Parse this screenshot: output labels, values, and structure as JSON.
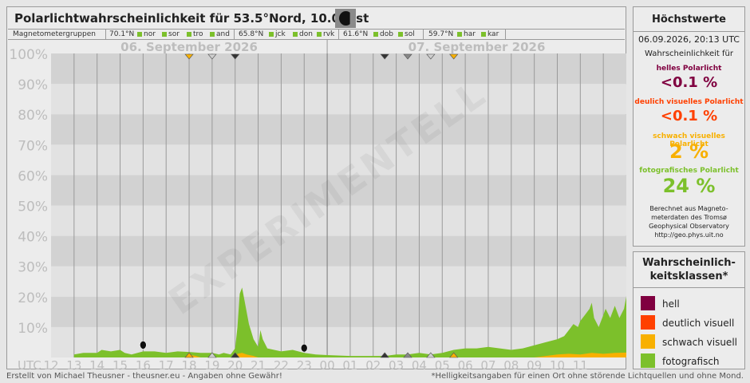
{
  "title": "Polarlichtwahrscheinlichkeit für  53.5°Nord, 10.0°Ost",
  "stations": {
    "label": "Magnetometergruppen",
    "groups": [
      {
        "lat": "70.1°N",
        "codes": [
          "nor",
          "sor",
          "tro",
          "and"
        ]
      },
      {
        "lat": "65.8°N",
        "codes": [
          "jck",
          "don",
          "rvk"
        ]
      },
      {
        "lat": "61.6°N",
        "codes": [
          "dob",
          "sol"
        ]
      },
      {
        "lat": "59.7°N",
        "codes": [
          "har",
          "kar"
        ]
      }
    ]
  },
  "colors": {
    "hell": "#800040",
    "deutlich": "#ff4000",
    "schwach": "#f8b000",
    "foto": "#7cc02b",
    "night_band": "#d2d2d2",
    "day_band": "#e2e2e2"
  },
  "chart_data": {
    "type": "area",
    "x_label": "UTC",
    "date_labels": [
      "06. September 2026",
      "07. September 2026"
    ],
    "hour_labels": [
      "12",
      "13",
      "14",
      "15",
      "16",
      "17",
      "18",
      "19",
      "20",
      "21",
      "22",
      "23",
      "00",
      "01",
      "02",
      "03",
      "04",
      "05",
      "06",
      "07",
      "08",
      "09",
      "10",
      "11"
    ],
    "y_ticks": [
      "10%",
      "20%",
      "30%",
      "40%",
      "50%",
      "60%",
      "70%",
      "80%",
      "90%",
      "100%"
    ],
    "ylim": [
      0,
      100
    ],
    "watermark": "EXPERIMENTELL",
    "series": [
      {
        "name": "fotografisch",
        "color_key": "foto",
        "points": [
          [
            12.0,
            0
          ],
          [
            13.0,
            0
          ],
          [
            13.0,
            1
          ],
          [
            13.4,
            1.5
          ],
          [
            14.0,
            1.5
          ],
          [
            14.2,
            2.5
          ],
          [
            14.6,
            2
          ],
          [
            15.0,
            2.5
          ],
          [
            15.2,
            1.5
          ],
          [
            15.5,
            1
          ],
          [
            16.0,
            2
          ],
          [
            16.5,
            2
          ],
          [
            17.0,
            1.5
          ],
          [
            17.5,
            2
          ],
          [
            18.0,
            1.8
          ],
          [
            18.5,
            1.5
          ],
          [
            19.0,
            1.5
          ],
          [
            19.3,
            1
          ],
          [
            19.5,
            1.5
          ],
          [
            19.8,
            1
          ],
          [
            20.0,
            3
          ],
          [
            20.1,
            10
          ],
          [
            20.2,
            21
          ],
          [
            20.3,
            23
          ],
          [
            20.45,
            17
          ],
          [
            20.6,
            11
          ],
          [
            20.8,
            6
          ],
          [
            21.0,
            3.5
          ],
          [
            21.1,
            9
          ],
          [
            21.2,
            6
          ],
          [
            21.4,
            3
          ],
          [
            21.7,
            2.5
          ],
          [
            22.0,
            2
          ],
          [
            22.5,
            2.5
          ],
          [
            23.0,
            1.5
          ],
          [
            23.5,
            1
          ],
          [
            24.0,
            0.8
          ],
          [
            25.0,
            0.5
          ],
          [
            26.0,
            0.5
          ],
          [
            26.5,
            0.5
          ],
          [
            27.0,
            1
          ],
          [
            27.5,
            1
          ],
          [
            28.0,
            1.5
          ],
          [
            28.5,
            1
          ],
          [
            29.0,
            1.5
          ],
          [
            29.5,
            2.5
          ],
          [
            30.0,
            3
          ],
          [
            30.5,
            3
          ],
          [
            31.0,
            3.5
          ],
          [
            31.5,
            3
          ],
          [
            32.0,
            2.5
          ],
          [
            32.5,
            3
          ],
          [
            33.0,
            4
          ],
          [
            33.5,
            5
          ],
          [
            34.0,
            6
          ],
          [
            34.3,
            7
          ],
          [
            34.5,
            9
          ],
          [
            34.7,
            11
          ],
          [
            34.9,
            10
          ],
          [
            35.0,
            12
          ],
          [
            35.2,
            14
          ],
          [
            35.4,
            16
          ],
          [
            35.5,
            18
          ],
          [
            35.6,
            13
          ],
          [
            35.8,
            10
          ],
          [
            36.0,
            14
          ],
          [
            36.1,
            16
          ],
          [
            36.3,
            13
          ],
          [
            36.5,
            17
          ],
          [
            36.7,
            13
          ],
          [
            36.9,
            16
          ],
          [
            37.0,
            20
          ]
        ]
      },
      {
        "name": "schwach visuell",
        "color_key": "schwach",
        "points": [
          [
            12.0,
            0
          ],
          [
            18.0,
            0
          ],
          [
            18.1,
            0.8
          ],
          [
            18.3,
            0.5
          ],
          [
            18.5,
            0
          ],
          [
            20.0,
            0
          ],
          [
            20.1,
            1.2
          ],
          [
            20.3,
            1.5
          ],
          [
            20.5,
            1
          ],
          [
            20.8,
            0.5
          ],
          [
            21.0,
            0
          ],
          [
            33.0,
            0
          ],
          [
            33.5,
            0.5
          ],
          [
            34.0,
            1
          ],
          [
            34.5,
            1.2
          ],
          [
            35.0,
            1
          ],
          [
            35.5,
            1.5
          ],
          [
            36.0,
            1.2
          ],
          [
            36.5,
            1.5
          ],
          [
            37.0,
            1.6
          ]
        ]
      }
    ],
    "activity_markers": {
      "day1": [
        {
          "hour": 18.0,
          "level": "schwach"
        },
        {
          "hour": 19.0,
          "level": "foto"
        },
        {
          "hour": 20.0,
          "level": "hell"
        }
      ],
      "day2": [
        {
          "hour": 26.5,
          "level": "hell"
        },
        {
          "hour": 27.5,
          "level": "grau"
        },
        {
          "hour": 28.5,
          "level": "foto"
        },
        {
          "hour": 29.5,
          "level": "schwach"
        }
      ]
    },
    "moon_markers": [
      {
        "hour": 16.0,
        "y": 2
      },
      {
        "hour": 23.0,
        "y": 1
      }
    ]
  },
  "maxima": {
    "heading": "Höchstwerte",
    "timestamp": "06.09.2026, 20:13 UTC",
    "intro": "Wahrscheinlichkeit für",
    "items": [
      {
        "label": "helles Polarlicht",
        "value": "<0.1 %",
        "color": "#800040"
      },
      {
        "label": "deulich visuelles Polarlicht",
        "value": "<0.1 %",
        "color": "#ff4000"
      },
      {
        "label": "schwach visuelles Polarlicht",
        "value": "2 %",
        "color": "#f8b000"
      },
      {
        "label": "fotografisches Polarlicht",
        "value": "24 %",
        "color": "#7cc02b"
      }
    ],
    "source_lines": [
      "Berechnet aus Magneto-",
      "meterdaten des Tromsø",
      "Geophysical Observatory",
      "http://geo.phys.uit.no"
    ]
  },
  "legend": {
    "heading_lines": [
      "Wahrscheinlich-",
      "keitsklassen*"
    ],
    "items": [
      {
        "label": "hell",
        "color": "#800040"
      },
      {
        "label": "deutlich visuell",
        "color": "#ff4000"
      },
      {
        "label": "schwach visuell",
        "color": "#f8b000"
      },
      {
        "label": "fotografisch",
        "color": "#7cc02b"
      }
    ]
  },
  "footer": {
    "left": "Erstellt von Michael Theusner - theusner.eu - Angaben ohne Gewähr!",
    "right": "*Helligkeitsangaben für einen Ort ohne störende Lichtquellen und ohne Mond."
  }
}
